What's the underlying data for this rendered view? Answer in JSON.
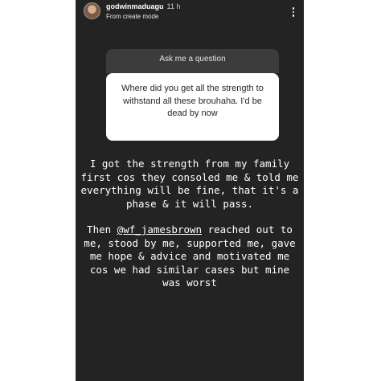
{
  "header": {
    "username": "godwinmaduagu",
    "time": "11 h",
    "subtitle": "From create mode"
  },
  "question": {
    "title": "Ask me a question",
    "text": "Where did you get all the strength to withstand all these brouhaha. I'd be dead by now"
  },
  "answer": {
    "paragraph1": "I got the strength from my family first cos they consoled me & told me everything will be fine, that it's a phase & it will pass.",
    "p2_prefix": "Then ",
    "mention": "@wf_jamesbrown",
    "p2_suffix": " reached out to me, stood by me, supported me, gave me hope & advice and motivated me cos we had similar cases but mine was worst"
  },
  "icons": {
    "more": "more-vertical-icon",
    "avatar": "profile-avatar"
  },
  "colors": {
    "story_background": "#232323",
    "question_header": "#3c3c3c",
    "question_body": "#ffffff",
    "text": "#ffffff"
  }
}
